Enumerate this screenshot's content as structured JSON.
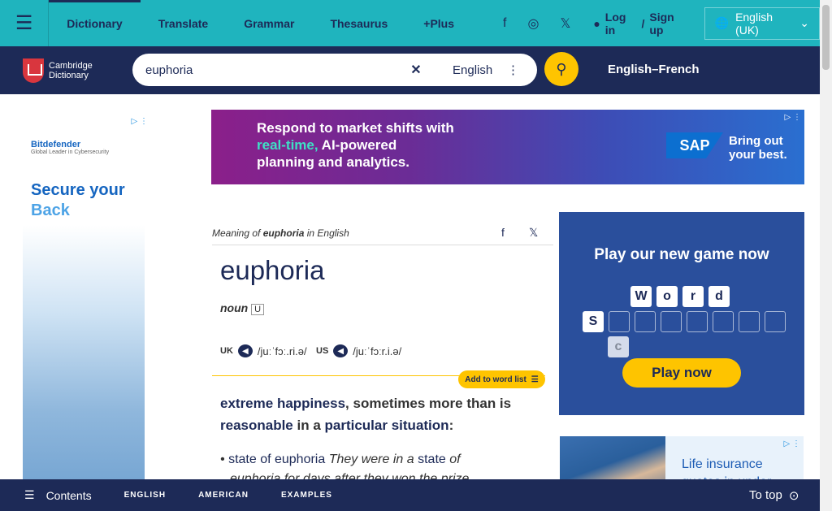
{
  "topbar": {
    "links": [
      "Dictionary",
      "Translate",
      "Grammar",
      "Thesaurus",
      "+Plus"
    ],
    "login": "Log in",
    "separator": "/",
    "signup": "Sign up",
    "language": "English (UK)"
  },
  "navbar": {
    "logo_line1": "Cambridge",
    "logo_line2": "Dictionary",
    "search_value": "euphoria",
    "clear_icon": "✕",
    "dictionary_select": "English",
    "language_pair": "English–French"
  },
  "ads": {
    "left_brand": "Bitdefender",
    "left_tagline": "Global Leader in Cybersecurity",
    "left_headline_1": "Secure your",
    "left_headline_2": "Back",
    "top_line1": "Respond to market shifts with",
    "top_line2_highlight": "real-time,",
    "top_line2_rest": " AI-powered",
    "top_line3": "planning and analytics.",
    "top_brand": "SAP",
    "top_cta_1": "Bring out",
    "top_cta_2": "your best.",
    "game_headline": "Play our new game now",
    "game_word": [
      "W",
      "o",
      "r",
      "d"
    ],
    "game_letter": "S",
    "game_extra": "c",
    "game_cta": "Play now",
    "ins_line1": "Life insurance",
    "ins_line2": "quotes in under"
  },
  "entry": {
    "meaning_prefix": "Meaning of ",
    "meaning_word": "euphoria",
    "meaning_suffix": " in English",
    "headword": "euphoria",
    "pos": "noun",
    "uk_label": "UK",
    "uk_ipa": "/juːˈfɔː.ri.ə/",
    "us_label": "US",
    "us_ipa": "/juːˈfɔːr.i.ə/",
    "add_to_list": "Add to word list",
    "def_link1": "extreme",
    "def_link2": "happiness",
    "def_text1": ", sometimes more than is",
    "def_link3": "reasonable",
    "def_text2": " in a ",
    "def_link4": "particular",
    "def_link5": "situation",
    "def_end": ":",
    "ex_bullet": "•",
    "ex_link1": "state of euphoria",
    "ex_text1": " They were in a ",
    "ex_link2": "state",
    "ex_text2": " of",
    "ex_line2": "euphoria for days after they won the prize."
  },
  "bottombar": {
    "contents": "Contents",
    "tab1": "ENGLISH",
    "tab2": "AMERICAN",
    "tab3": "EXAMPLES",
    "to_top": "To top"
  },
  "colors": {
    "brand_teal": "#1fb4be",
    "brand_navy": "#1d2a57",
    "accent_yellow": "#fec400"
  }
}
